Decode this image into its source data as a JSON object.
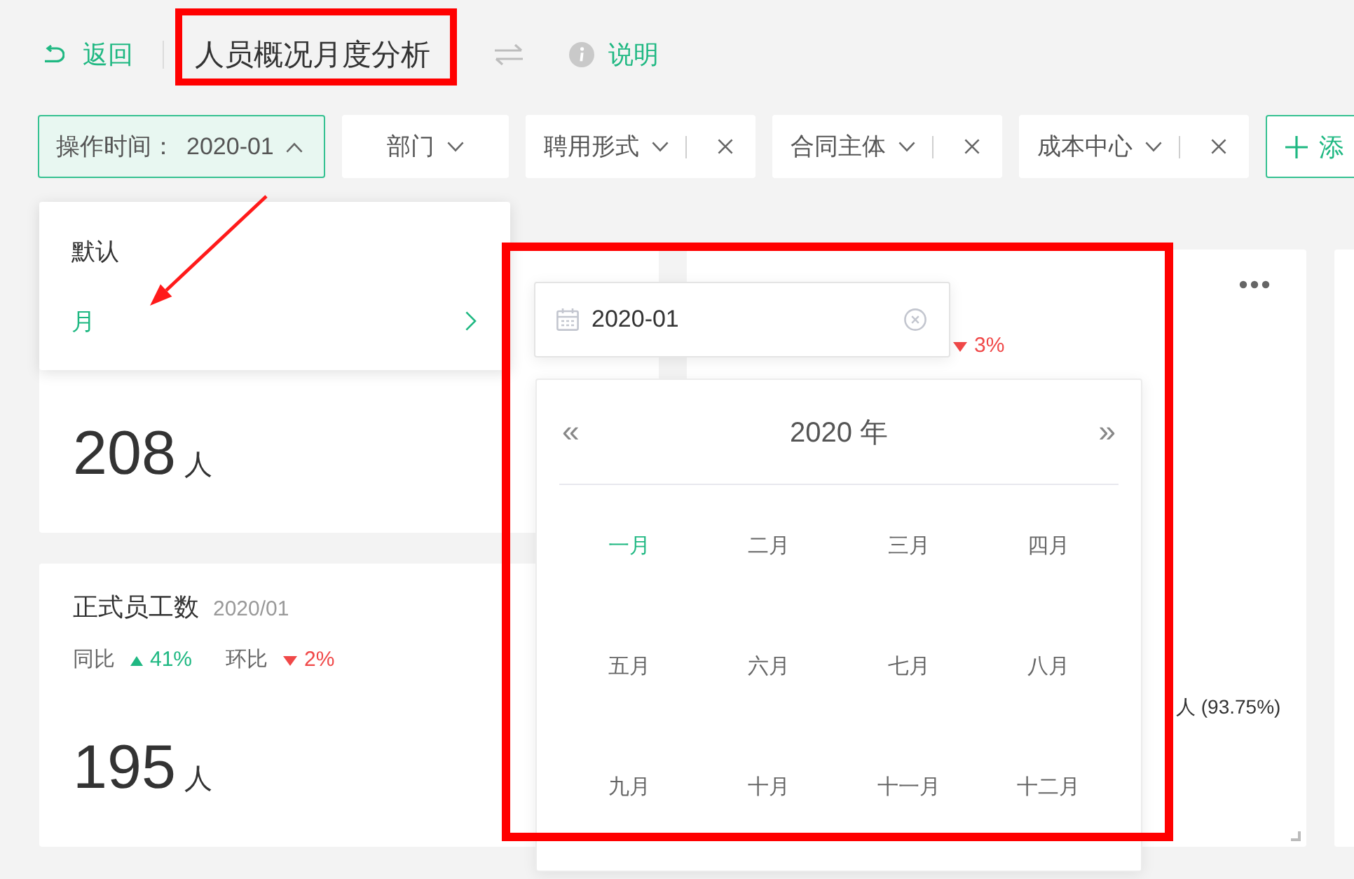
{
  "header": {
    "back_label": "返回",
    "title": "人员概况月度分析",
    "help_label": "说明"
  },
  "filters": [
    {
      "kind": "range",
      "label": "操作时间：",
      "value": "2020-01",
      "expanded": true
    },
    {
      "kind": "select",
      "label": "部门",
      "expanded": false
    },
    {
      "kind": "removable",
      "label": "聘用形式",
      "expanded": false
    },
    {
      "kind": "removable",
      "label": "合同主体",
      "expanded": false
    },
    {
      "kind": "removable",
      "label": "成本中心",
      "expanded": false
    }
  ],
  "add_filter": {
    "label": "添"
  },
  "period_menu": {
    "items": [
      {
        "label": "默认",
        "selected": false,
        "has_submenu": false
      },
      {
        "label": "月",
        "selected": true,
        "has_submenu": true
      }
    ]
  },
  "month_picker": {
    "value": "2020-01",
    "prev": "«",
    "year": "2020 年",
    "next": "»",
    "months": [
      {
        "label": "一月",
        "selected": true
      },
      {
        "label": "二月",
        "selected": false
      },
      {
        "label": "三月",
        "selected": false
      },
      {
        "label": "四月",
        "selected": false
      },
      {
        "label": "五月",
        "selected": false
      },
      {
        "label": "六月",
        "selected": false
      },
      {
        "label": "七月",
        "selected": false
      },
      {
        "label": "八月",
        "selected": false
      },
      {
        "label": "九月",
        "selected": false
      },
      {
        "label": "十月",
        "selected": false
      },
      {
        "label": "十一月",
        "selected": false
      },
      {
        "label": "十二月",
        "selected": false
      }
    ]
  },
  "cards": [
    {
      "kind": "metric",
      "value": "208",
      "unit": "人"
    },
    {
      "kind": "metric",
      "title": "正式员工数",
      "date": "2020/01",
      "comparisons": [
        {
          "label": "同比",
          "value": "41%",
          "increase": true
        },
        {
          "label": "环比",
          "value": "2%",
          "increase": false
        }
      ],
      "value": "195",
      "unit": "人"
    },
    {
      "kind": "chart",
      "change": {
        "value": "3%",
        "increase": false
      },
      "legend_text": "人 (93.75%)"
    },
    {
      "kind": "blank"
    }
  ]
}
